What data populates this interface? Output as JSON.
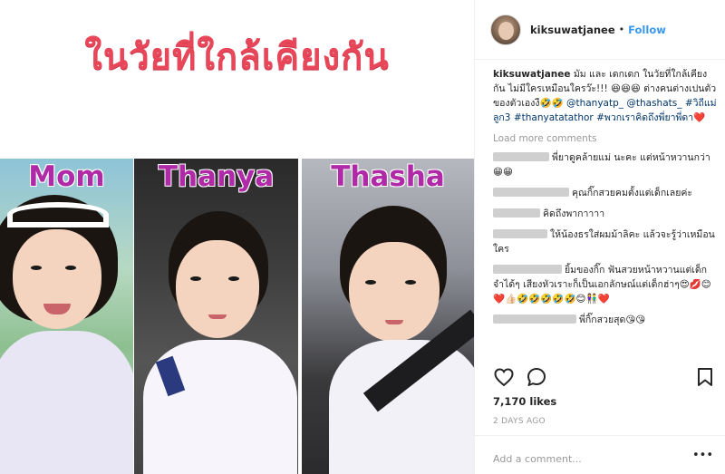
{
  "post_image": {
    "headline": "ในวัยที่ใกล้เคียงกัน",
    "labels": [
      "Mom",
      "Thanya",
      "Thasha"
    ]
  },
  "header": {
    "username": "kiksuwatjanee",
    "dot": "•",
    "follow": "Follow"
  },
  "caption": {
    "username": "kiksuwatjanee",
    "text": "มัม และ เดกเดก ในวัยที่ใกล้เคียงกัน ไม่มีใครเหมือนใครว๊ะ!!! 😆😆😆 ต่างคนต่างเปนตัวของตัวเองงื🤣🤣",
    "mention1": "@thanyatp_",
    "mention2": "@thashats_",
    "tag1": "#วิถีแม่ลูก3",
    "tag2": "#thanyatatathor",
    "tag3": "#พวกเราคิดถึงพี่ยาพี่ดา",
    "heart": "❤️"
  },
  "load_more": "Load more comments",
  "comments": [
    {
      "text": "พี่ยาดูคล้ายแม่ นะคะ แต่หน้าหวานกว่า😁😁"
    },
    {
      "text": "คุณกิ๊กสวยคมตั้งแต่เด็กเลยค่ะ"
    },
    {
      "text": "คิดถึงพากาาาา"
    },
    {
      "text": "ให้น้องธรใส่ผมม้าลิคะ แล้วจะรู้ว่าเหมือนใคร"
    },
    {
      "text": "ยิ้มของกิ๊ก ฟันสวยหน้าหวานแต่เด็ก จำได้ๆ เสียงหัวเราะก็เป็นเอกลักษณ์แต่เด็กฮ่าๆ😍💋😊❤️👍🏻🤣🤣🤣🤣🤣😊👫❤️"
    },
    {
      "text": "พี่กิ๊กสวยสุด😘😘"
    }
  ],
  "likes": "7,170 likes",
  "time": "2 DAYS AGO",
  "comment_box": {
    "placeholder": "Add a comment..."
  },
  "more_icon": "more-dots-icon",
  "colors": {
    "accent": "#3897f0",
    "headline": "#e8475a",
    "label": "#b02aa8"
  }
}
